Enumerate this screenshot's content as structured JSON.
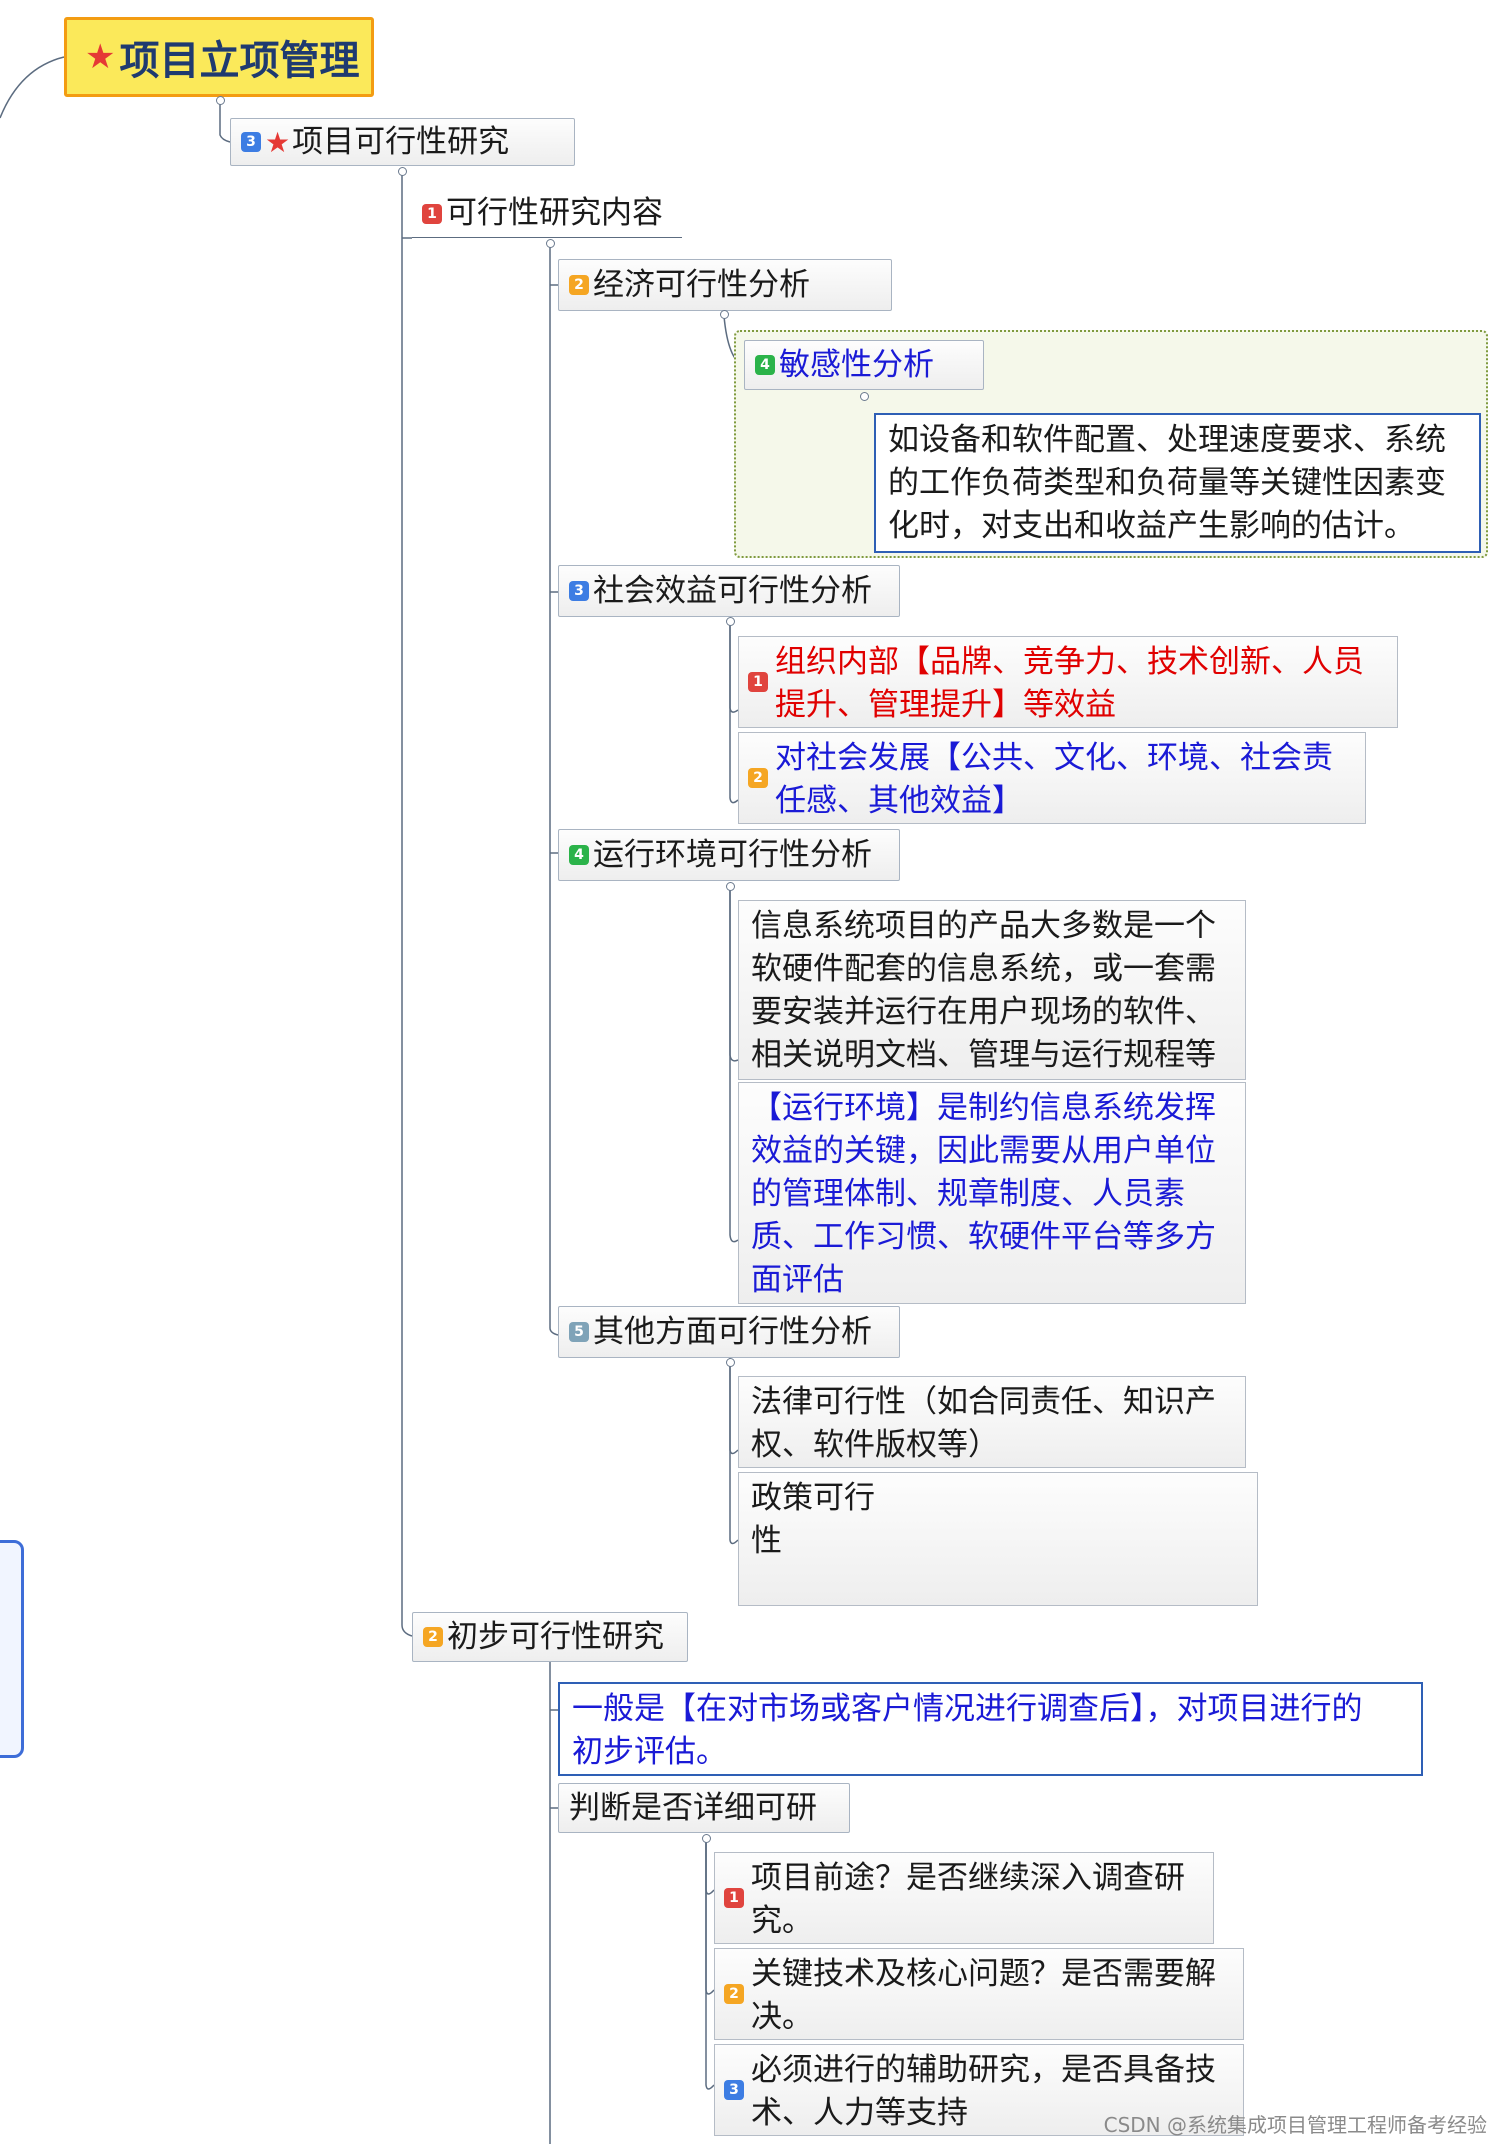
{
  "root": {
    "label": "项目立项管理",
    "icon": "star-icon"
  },
  "level1": {
    "badge": "3",
    "label": "项目可行性研究",
    "icon": "star-icon"
  },
  "content": {
    "badge": "1",
    "label": "可行性研究内容"
  },
  "economic": {
    "badge": "2",
    "label": "经济可行性分析",
    "sensitivity": {
      "badge": "4",
      "label": "敏感性分析"
    },
    "desc": [
      "如设备和软件配置、处理速度要求、系统",
      "的工作负荷类型和负荷量等关键性因素变",
      "化时，对支出和收益产生影响的估计。"
    ]
  },
  "social": {
    "badge": "3",
    "label": "社会效益可行性分析",
    "items": [
      {
        "badge": "1",
        "lines": [
          "组织内部【品牌、竞争力、技术创新、人员",
          "提升、管理提升】等效益"
        ]
      },
      {
        "badge": "2",
        "lines": [
          "对社会发展【公共、文化、环境、社会责",
          "任感、其他效益】"
        ]
      }
    ]
  },
  "operation": {
    "badge": "4",
    "label": "运行环境可行性分析",
    "items": [
      {
        "lines": [
          "信息系统项目的产品大多数是一个",
          "软硬件配套的信息系统，或一套需",
          "要安装并运行在用户现场的软件、",
          "相关说明文档、管理与运行规程等"
        ]
      },
      {
        "lines": [
          "【运行环境】是制约信息系统发挥",
          "效益的关键，因此需要从用户单位",
          "的管理体制、规章制度、人员素",
          "质、工作习惯、软硬件平台等多方",
          "面评估"
        ]
      }
    ]
  },
  "other": {
    "badge": "5",
    "label": "其他方面可行性分析",
    "items": [
      {
        "lines": [
          "法律可行性（如合同责任、知识产",
          "权、软件版权等）"
        ]
      },
      {
        "lines": [
          "政策可行",
          "性"
        ]
      }
    ]
  },
  "prelim": {
    "badge": "2",
    "label": "初步可行性研究",
    "desc": [
      "一般是【在对市场或客户情况进行调查后】，对项目进行的",
      "初步评估。"
    ],
    "judge": {
      "label": "判断是否详细可研",
      "items": [
        {
          "badge": "1",
          "lines": [
            "项目前途？是否继续深入调查研",
            "究。"
          ]
        },
        {
          "badge": "2",
          "lines": [
            "关键技术及核心问题？是否需要解",
            "决。"
          ]
        },
        {
          "badge": "3",
          "lines": [
            "必须进行的辅助研究，是否具备技",
            "术、人力等支持"
          ]
        }
      ]
    }
  },
  "watermark": "CSDN @系统集成项目管理工程师备考经验"
}
